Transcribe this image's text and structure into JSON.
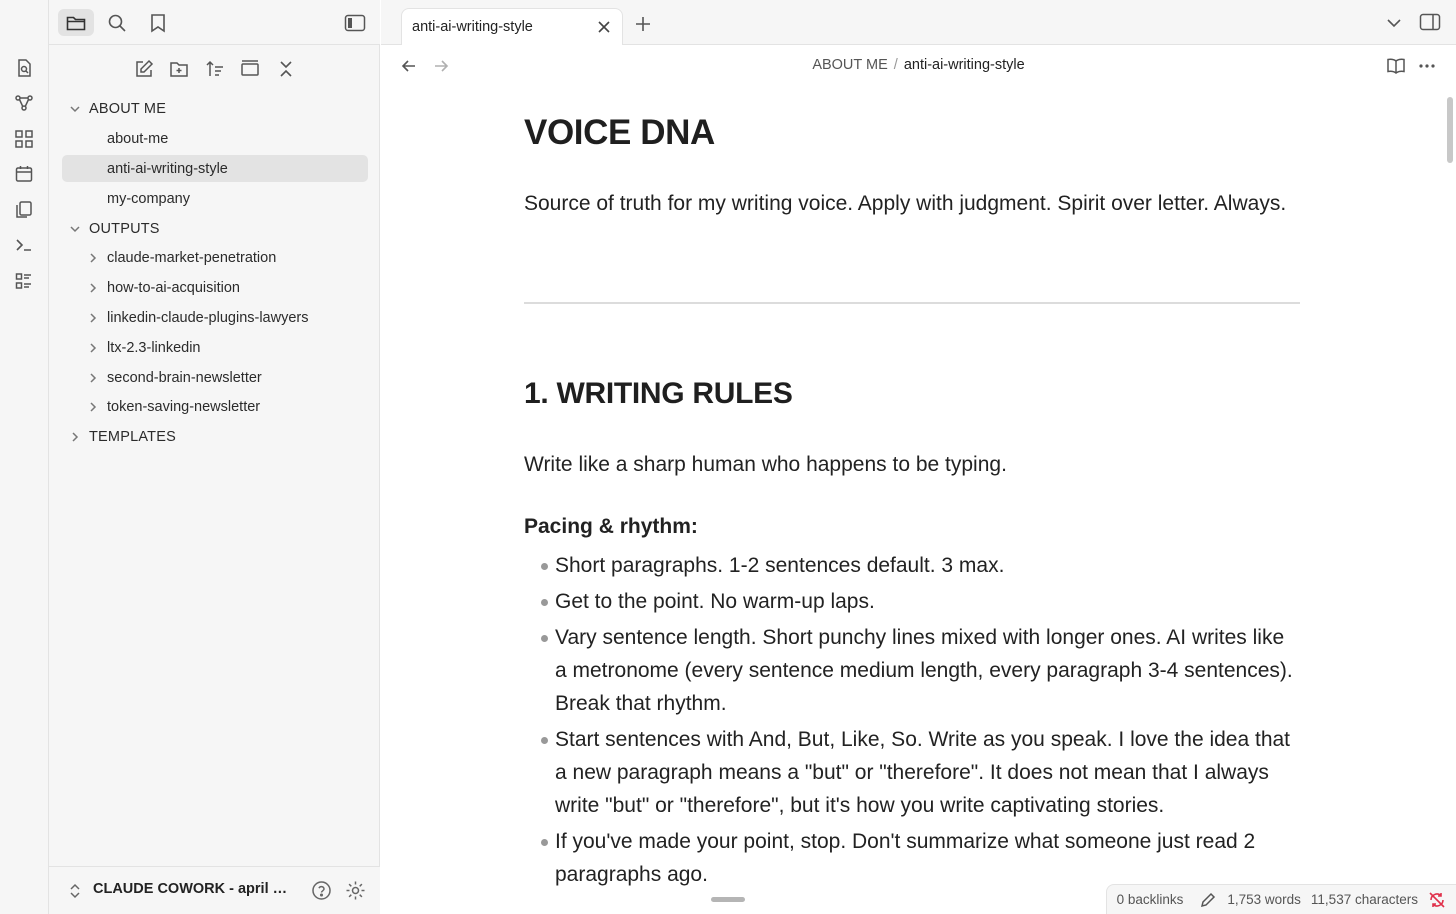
{
  "sidebar": {
    "actions": [
      "new-note",
      "new-folder",
      "sort",
      "auto-reveal",
      "collapse-all"
    ],
    "tree": [
      {
        "type": "folder",
        "label": "ABOUT ME",
        "expanded": true
      },
      {
        "type": "file",
        "label": "about-me"
      },
      {
        "type": "file",
        "label": "anti-ai-writing-style",
        "selected": true
      },
      {
        "type": "file",
        "label": "my-company"
      },
      {
        "type": "folder",
        "label": "OUTPUTS",
        "expanded": true
      },
      {
        "type": "subfolder",
        "label": "claude-market-penetration"
      },
      {
        "type": "subfolder",
        "label": "how-to-ai-acquisition"
      },
      {
        "type": "subfolder",
        "label": "linkedin-claude-plugins-lawyers"
      },
      {
        "type": "subfolder",
        "label": "ltx-2.3-linkedin"
      },
      {
        "type": "subfolder",
        "label": "second-brain-newsletter"
      },
      {
        "type": "subfolder",
        "label": "token-saving-newsletter"
      },
      {
        "type": "folder",
        "label": "TEMPLATES",
        "expanded": false
      }
    ],
    "vault_name": "CLAUDE COWORK - april update"
  },
  "tab": {
    "title": "anti-ai-writing-style"
  },
  "breadcrumb": {
    "folder": "ABOUT ME",
    "separator": "/",
    "file": "anti-ai-writing-style"
  },
  "doc": {
    "h1": "VOICE DNA",
    "intro": "Source of truth for my writing voice. Apply with judgment. Spirit over letter. Always.",
    "h2": "1. WRITING RULES",
    "p2": "Write like a sharp human who happens to be typing.",
    "h3": "Pacing & rhythm:",
    "bullets": [
      "Short paragraphs. 1-2 sentences default. 3 max.",
      "Get to the point. No warm-up laps.",
      "Vary sentence length. Short punchy lines mixed with longer ones. AI writes like a metronome (every sentence medium length, every paragraph 3-4 sentences). Break that rhythm.",
      "Start sentences with And, But, Like, So. Write as you speak. I love the idea that a new paragraph means a \"but\" or \"therefore\". It does not mean that I always write \"but\" or \"therefore\", but it's how you write captivating stories.",
      "If you've made your point, stop. Don't summarize what someone just read 2 paragraphs ago."
    ]
  },
  "status": {
    "backlinks": "0 backlinks",
    "words": "1,753 words",
    "characters": "11,537 characters"
  },
  "colors": {
    "sidebar_bg": "#f6f6f6",
    "selected_bg": "#e3e3e3",
    "text": "#222222",
    "sync_error": "#e0314b"
  }
}
